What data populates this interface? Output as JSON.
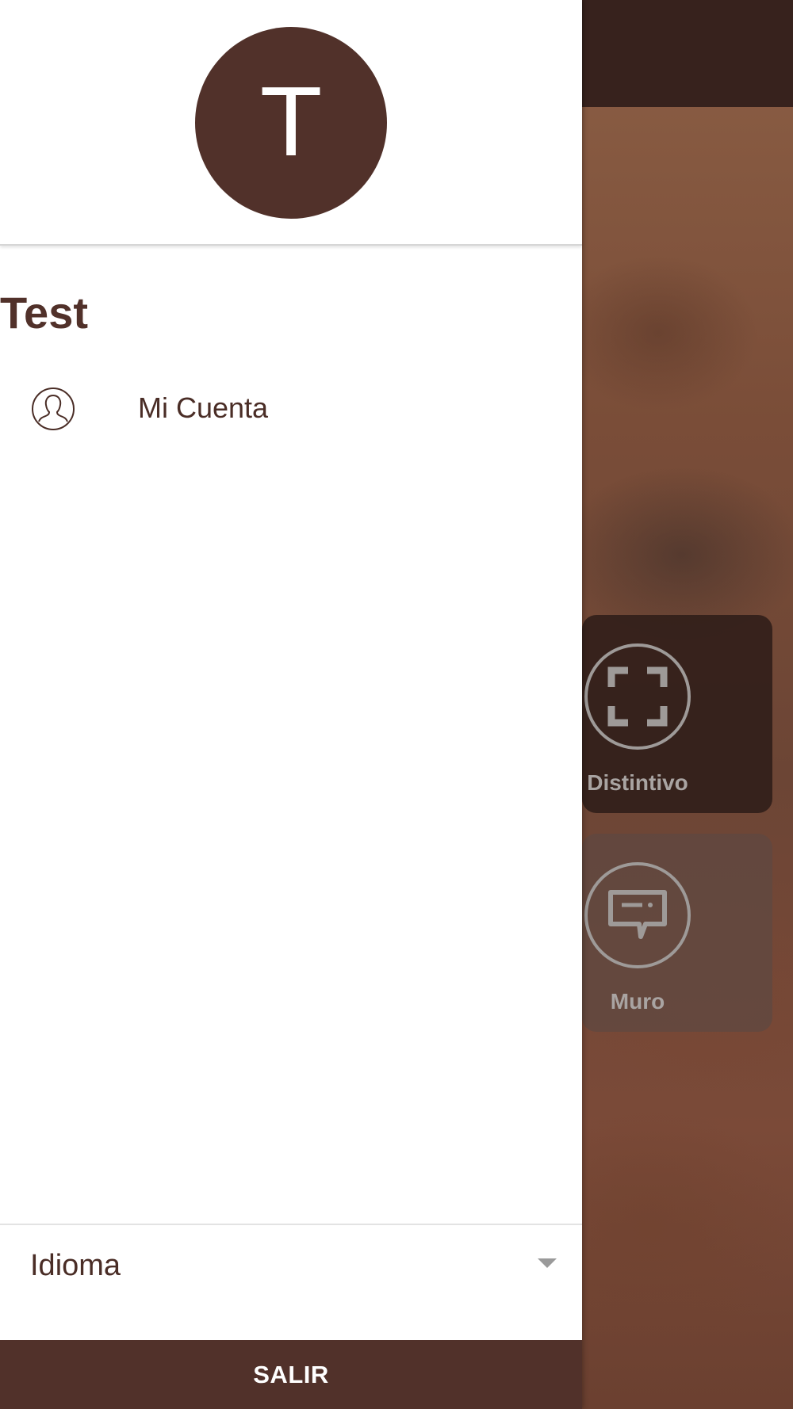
{
  "drawer": {
    "avatar_initial": "T",
    "user_name": "Test",
    "menu": [
      {
        "label": "Mi Cuenta",
        "icon": "user-circle-icon"
      }
    ],
    "language": {
      "label": "Idioma",
      "icon": "caret-down-icon"
    },
    "logout_label": "SALIR"
  },
  "background": {
    "tiles": [
      {
        "label": "Distintivo",
        "icon": "fullscreen-icon"
      },
      {
        "label": "Muro",
        "icon": "chat-bubble-icon"
      }
    ]
  },
  "colors": {
    "brand": "#51312a",
    "topbar": "#37221d",
    "text_dark": "#4a2d26"
  }
}
